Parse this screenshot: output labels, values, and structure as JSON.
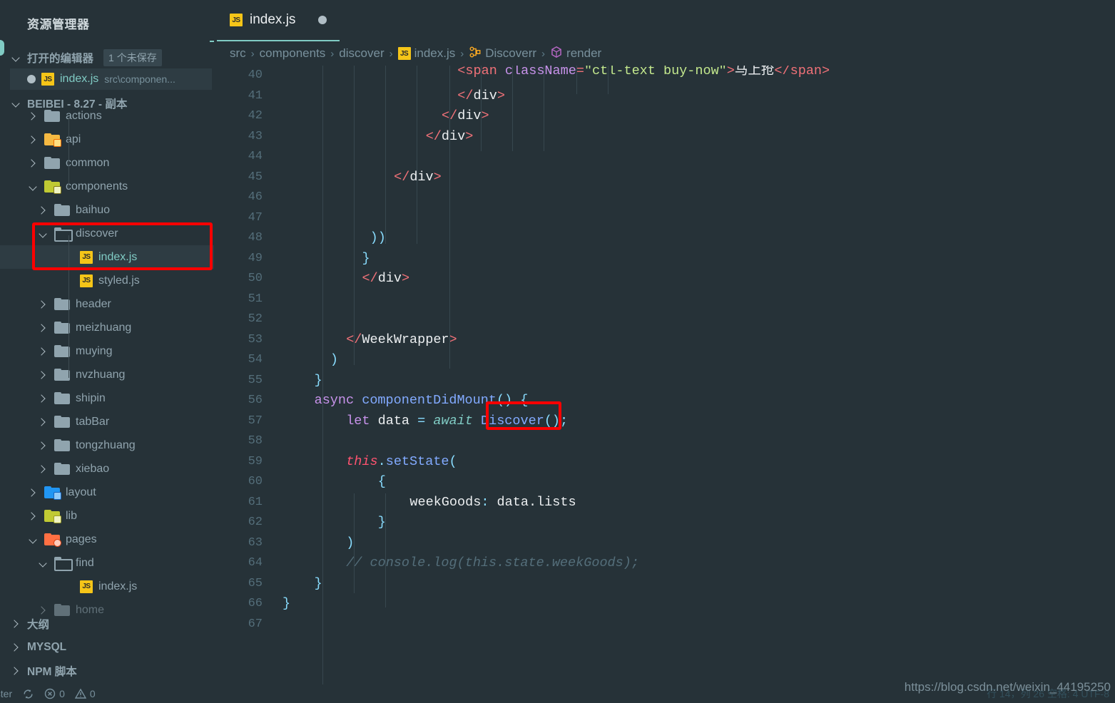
{
  "sidebar": {
    "title": "资源管理器",
    "open_editors": {
      "label": "打开的编辑器",
      "badge": "1 个未保存",
      "item": {
        "name": "index.js",
        "path": "src\\componen...",
        "icon": "js-file-icon",
        "dirty": true
      }
    },
    "project": {
      "label": "BEIBEI - 8.27 - 副本"
    },
    "tree": [
      {
        "label": "actions",
        "depth": 1,
        "expanded": false,
        "kind": "folder",
        "color": "plain"
      },
      {
        "label": "api",
        "depth": 1,
        "expanded": false,
        "kind": "folder",
        "color": "yellow"
      },
      {
        "label": "common",
        "depth": 1,
        "expanded": false,
        "kind": "folder",
        "color": "plain"
      },
      {
        "label": "components",
        "depth": 1,
        "expanded": true,
        "kind": "folder",
        "color": "ygreen"
      },
      {
        "label": "baihuo",
        "depth": 2,
        "expanded": false,
        "kind": "folder",
        "color": "plain"
      },
      {
        "label": "discover",
        "depth": 2,
        "expanded": true,
        "kind": "folder",
        "color": "openplain"
      },
      {
        "label": "index.js",
        "depth": 3,
        "expanded": null,
        "kind": "file",
        "color": "js",
        "selected": true,
        "active": true
      },
      {
        "label": "styled.js",
        "depth": 3,
        "expanded": null,
        "kind": "file",
        "color": "js"
      },
      {
        "label": "header",
        "depth": 2,
        "expanded": false,
        "kind": "folder",
        "color": "plain"
      },
      {
        "label": "meizhuang",
        "depth": 2,
        "expanded": false,
        "kind": "folder",
        "color": "plain"
      },
      {
        "label": "muying",
        "depth": 2,
        "expanded": false,
        "kind": "folder",
        "color": "plain"
      },
      {
        "label": "nvzhuang",
        "depth": 2,
        "expanded": false,
        "kind": "folder",
        "color": "plain"
      },
      {
        "label": "shipin",
        "depth": 2,
        "expanded": false,
        "kind": "folder",
        "color": "plain"
      },
      {
        "label": "tabBar",
        "depth": 2,
        "expanded": false,
        "kind": "folder",
        "color": "plain"
      },
      {
        "label": "tongzhuang",
        "depth": 2,
        "expanded": false,
        "kind": "folder",
        "color": "plain"
      },
      {
        "label": "xiebao",
        "depth": 2,
        "expanded": false,
        "kind": "folder",
        "color": "plain"
      },
      {
        "label": "layout",
        "depth": 1,
        "expanded": false,
        "kind": "folder",
        "color": "blue"
      },
      {
        "label": "lib",
        "depth": 1,
        "expanded": false,
        "kind": "folder",
        "color": "olive"
      },
      {
        "label": "pages",
        "depth": 1,
        "expanded": true,
        "kind": "folder",
        "color": "orange"
      },
      {
        "label": "find",
        "depth": 2,
        "expanded": true,
        "kind": "folder",
        "color": "openplain"
      },
      {
        "label": "index.js",
        "depth": 3,
        "expanded": null,
        "kind": "file",
        "color": "js"
      },
      {
        "label": "home",
        "depth": 2,
        "expanded": false,
        "kind": "folder",
        "color": "plain",
        "clipped": true
      }
    ],
    "bottom_sections": [
      {
        "label": "大纲"
      },
      {
        "label": "MYSQL"
      },
      {
        "label": "NPM 脚本"
      }
    ]
  },
  "editor": {
    "tab": {
      "label": "index.js",
      "icon": "js-file-icon",
      "dirty_dot": "●"
    },
    "breadcrumb": [
      {
        "label": "src",
        "icon": null
      },
      {
        "label": "components",
        "icon": null
      },
      {
        "label": "discover",
        "icon": null
      },
      {
        "label": "index.js",
        "icon": "js-file-icon"
      },
      {
        "label": "Discoverr",
        "icon": "class-icon"
      },
      {
        "label": "render",
        "icon": "method-icon"
      }
    ],
    "separator": "›",
    "first_line_number": 40,
    "last_line_number": 67,
    "lines": [
      {
        "n": 40,
        "text": "<span className=\"ctl-text buy-now\">马上抢</span>",
        "clipped_top": true
      },
      {
        "n": 41,
        "text": "</div>"
      },
      {
        "n": 42,
        "text": "</div>"
      },
      {
        "n": 43,
        "text": "</div>"
      },
      {
        "n": 44,
        "text": ""
      },
      {
        "n": 45,
        "text": "</div>"
      },
      {
        "n": 46,
        "text": ""
      },
      {
        "n": 47,
        "text": ""
      },
      {
        "n": 48,
        "text": "))"
      },
      {
        "n": 49,
        "text": "}"
      },
      {
        "n": 50,
        "text": "</div>"
      },
      {
        "n": 51,
        "text": ""
      },
      {
        "n": 52,
        "text": ""
      },
      {
        "n": 53,
        "text": "</WeekWrapper>"
      },
      {
        "n": 54,
        "text": ")"
      },
      {
        "n": 55,
        "text": "}"
      },
      {
        "n": 56,
        "text": "async componentDidMount() {"
      },
      {
        "n": 57,
        "text": "let data = await Discover();"
      },
      {
        "n": 58,
        "text": ""
      },
      {
        "n": 59,
        "text": "this.setState("
      },
      {
        "n": 60,
        "text": "{"
      },
      {
        "n": 61,
        "text": "weekGoods: data.lists"
      },
      {
        "n": 62,
        "text": "}"
      },
      {
        "n": 63,
        "text": ")"
      },
      {
        "n": 64,
        "text": "// console.log(this.state.weekGoods);"
      },
      {
        "n": 65,
        "text": "}"
      },
      {
        "n": 66,
        "text": "}"
      },
      {
        "n": 67,
        "text": ""
      }
    ],
    "highlight_token": "Discover"
  },
  "statusbar": {
    "branch": "aster",
    "sync_icon": "sync-icon",
    "error_icon": "error-icon",
    "error_count": "0",
    "warning_icon": "warning-icon",
    "warning_count": "0",
    "right_text": "行 14，列 26     空格: 4     UTF-8"
  },
  "watermark": "https://blog.csdn.net/weixin_44195250",
  "colors": {
    "background": "#263238",
    "accent": "#80cbc4",
    "highlight_red": "#ff0000",
    "selection": "#2e3c43"
  }
}
